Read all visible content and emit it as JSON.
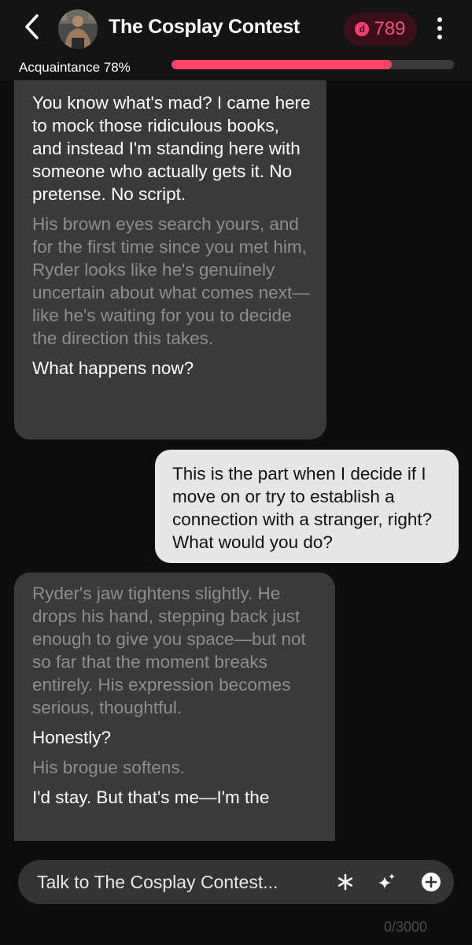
{
  "header": {
    "title": "The Cosplay Contest",
    "coins": "789",
    "coin_symbol": "d",
    "acquaintance_label": "Acquaintance 78%",
    "acquaintance_value": 0.78
  },
  "messages": {
    "m1": {
      "p1": "You know what's mad? I came here to mock those ridiculous books, and instead I'm standing here with someone who actually gets it. No pretense. No script.",
      "p2": "His brown eyes search yours, and for the first time since you met him, Ryder looks like he's genuinely uncertain about what comes next—like he's waiting for you to decide the direction this takes.",
      "p3": "What happens now?"
    },
    "m2": {
      "text": "This is the part when I decide if I move on or try to establish a connection with a stranger, right? What would you do?"
    },
    "m3": {
      "p1": "Ryder's jaw tightens slightly. He drops his hand, stepping back just enough to give you space—but not so far that the moment breaks entirely. His expression becomes serious, thoughtful.",
      "p2": "Honestly?",
      "p3": "His brogue softens.",
      "p4": "I'd stay. But that's me—I'm the"
    }
  },
  "input": {
    "placeholder": "Talk to The Cosplay Contest...",
    "counter": "0/3000"
  },
  "colors": {
    "accent": "#ff4364",
    "coin_bg": "#3a0f1c",
    "ai_bubble": "#3a3a3a",
    "user_bubble": "#e6e6e6"
  }
}
